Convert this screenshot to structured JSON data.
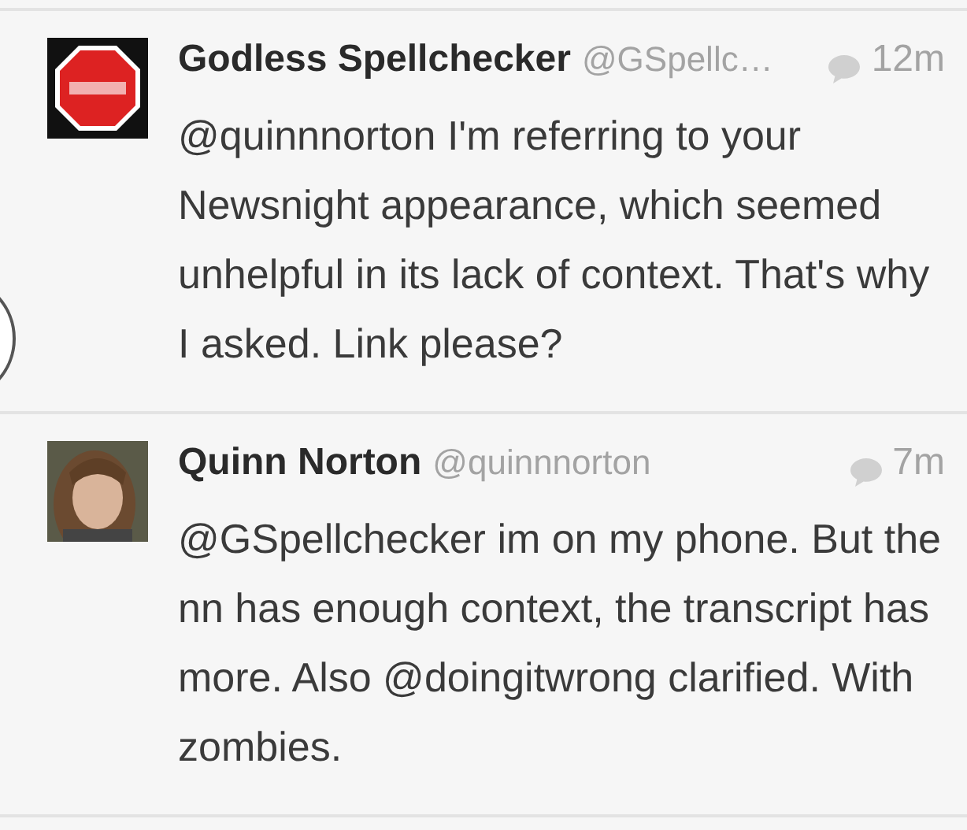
{
  "tweets": [
    {
      "name": "Godless Spellchecker",
      "handle": "@GSpellc…",
      "time": "12m",
      "text": "@quinnnorton I'm referring to your Newsnight appearance, which seemed unhelpful in its lack of context. That's why I asked. Link please?"
    },
    {
      "name": "Quinn Norton",
      "handle": "@quinnnorton",
      "time": "7m",
      "text": "@GSpellchecker im on my phone. But the nn has enough context, the transcript has more. Also @doingitwrong clarified. With zombies."
    }
  ]
}
